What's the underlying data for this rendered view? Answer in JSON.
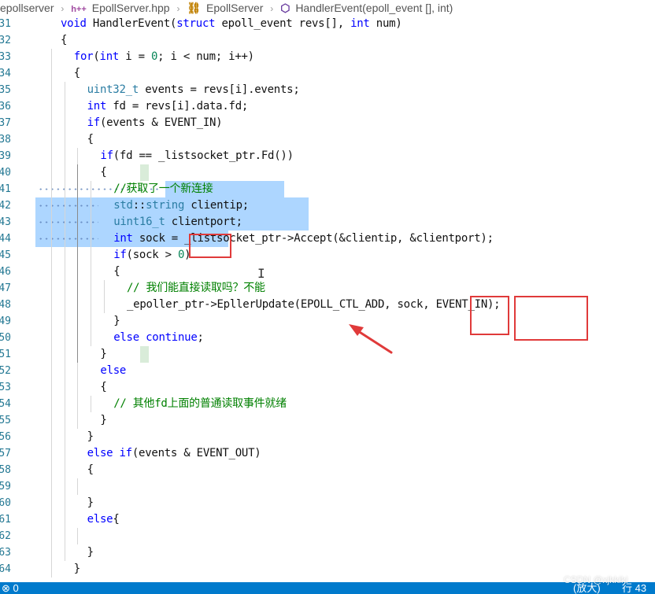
{
  "breadcrumb": {
    "segments": [
      {
        "text": "epollserver",
        "icon": ""
      },
      {
        "text": "EpollServer.hpp",
        "icon": "h-file-icon",
        "glyph": "h++"
      },
      {
        "text": "EpollServer",
        "icon": "class-icon",
        "glyph": "⛓"
      },
      {
        "text": "HandlerEvent(epoll_event [], int)",
        "icon": "method-icon",
        "glyph": "⬡"
      }
    ]
  },
  "lines": [
    {
      "num": "36",
      "text": "}"
    },
    {
      "num": "31",
      "text": "void HandlerEvent(struct epoll_event revs[], int num)"
    },
    {
      "num": "32",
      "text": "{"
    },
    {
      "num": "33",
      "text": "for(int i = 0; i < num; i++)"
    },
    {
      "num": "34",
      "text": "{"
    },
    {
      "num": "35",
      "text": "uint32_t events = revs[i].events;"
    },
    {
      "num": "36",
      "text": "int fd = revs[i].data.fd;"
    },
    {
      "num": "37",
      "text": "if(events & EVENT_IN)"
    },
    {
      "num": "38",
      "text": "{"
    },
    {
      "num": "39",
      "text": "if(fd == _listsocket_ptr.Fd())"
    },
    {
      "num": "40",
      "text": "{"
    },
    {
      "num": "41",
      "text": "//获取了一个新连接"
    },
    {
      "num": "42",
      "text": "std::string clientip;"
    },
    {
      "num": "43",
      "text": "uint16_t clientport;"
    },
    {
      "num": "44",
      "text": "int sock = _listsocket_ptr->Accept(&clientip, &clientport);"
    },
    {
      "num": "45",
      "text": "if(sock > 0)"
    },
    {
      "num": "46",
      "text": "{"
    },
    {
      "num": "47",
      "text": "// 我们能直接读取吗？不能"
    },
    {
      "num": "48",
      "text": "_epoller_ptr->EpllerUpdate(EPOLL_CTL_ADD, sock, EVENT_IN);"
    },
    {
      "num": "49",
      "text": "}"
    },
    {
      "num": "50",
      "text": "else continue;"
    },
    {
      "num": "51",
      "text": "}"
    },
    {
      "num": "52",
      "text": "else"
    },
    {
      "num": "53",
      "text": "{"
    },
    {
      "num": "54",
      "text": "// 其他fd上面的普通读取事件就绪"
    },
    {
      "num": "55",
      "text": "}"
    },
    {
      "num": "56",
      "text": "}"
    },
    {
      "num": "57",
      "text": "else if(events & EVENT_OUT)"
    },
    {
      "num": "58",
      "text": "{"
    },
    {
      "num": "59",
      "text": ""
    },
    {
      "num": "60",
      "text": "}"
    },
    {
      "num": "61",
      "text": "else{"
    },
    {
      "num": "62",
      "text": ""
    },
    {
      "num": "63",
      "text": "}"
    },
    {
      "num": "64",
      "text": "}"
    }
  ],
  "cursor_glyph": "I",
  "status": {
    "left": "⊗ 0",
    "zoom": "(放大)",
    "line_label": "行 43"
  },
  "watermark": "CSDN @xjkkiki",
  "colors": {
    "keyword": "#0000ff",
    "type": "#2b7da3",
    "comment": "#008000",
    "number": "#098658",
    "selection": "#add6ff",
    "annotation": "#e03a3a",
    "statusbar": "#007acc"
  }
}
